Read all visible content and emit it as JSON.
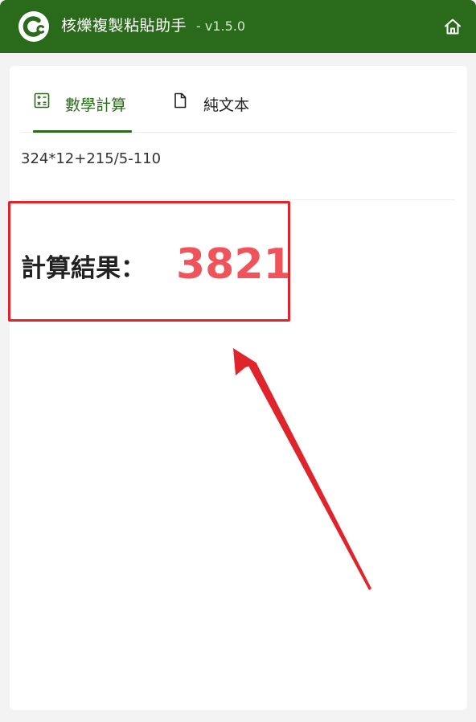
{
  "header": {
    "app_title": "核爍複製粘貼助手",
    "version": "- v1.5.0",
    "logo_icon": "cc-logo-icon",
    "home_icon": "home-icon",
    "background_color": "#2a6b1b"
  },
  "tabs": [
    {
      "label": "數學計算",
      "icon": "calculator-icon",
      "active": true
    },
    {
      "label": "純文本",
      "icon": "document-icon",
      "active": false
    }
  ],
  "expression": "324*12+215/5-110",
  "result": {
    "label": "計算結果：",
    "value": "3821",
    "value_color": "#f0545b"
  },
  "annotation": {
    "color": "#e0242c",
    "shapes": [
      "highlight-box",
      "arrow"
    ]
  }
}
